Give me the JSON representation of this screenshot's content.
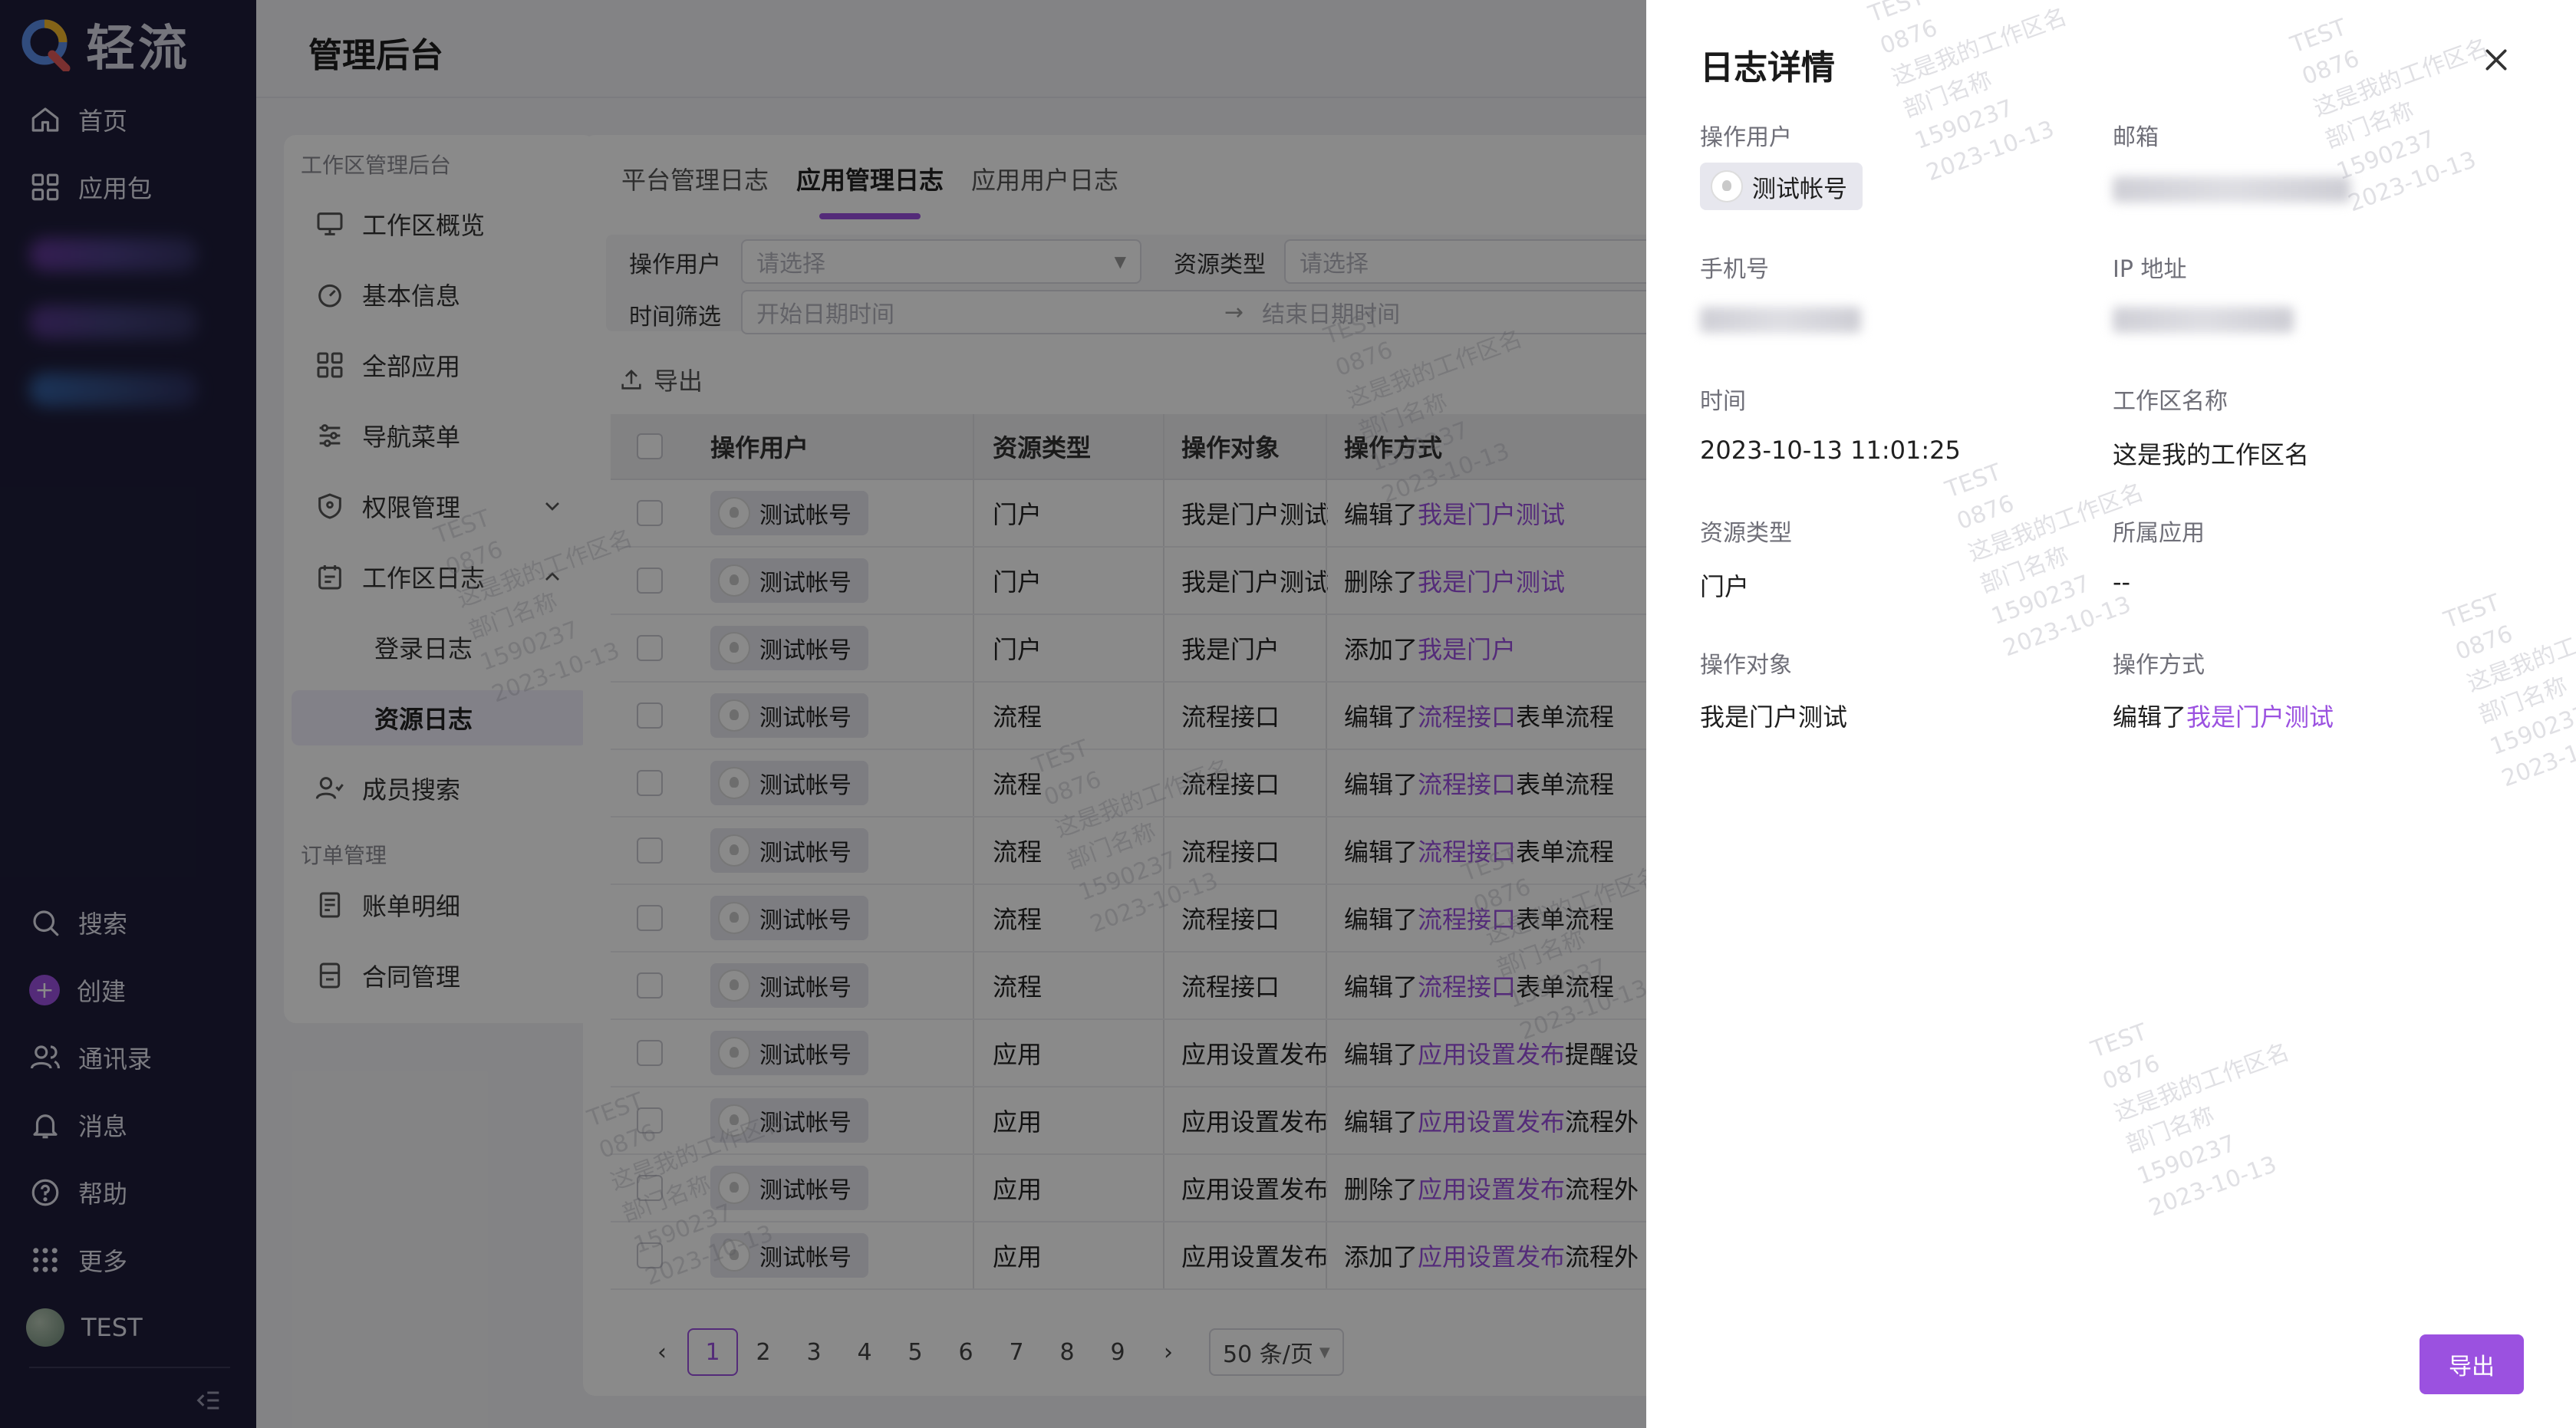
{
  "brand": {
    "name": "轻流"
  },
  "nav": {
    "top_items": [
      {
        "label": "首页",
        "icon": "home-icon"
      },
      {
        "label": "应用包",
        "icon": "grid-icon"
      }
    ],
    "bottom_items": [
      {
        "label": "搜索",
        "icon": "search-icon"
      },
      {
        "label": "创建",
        "icon": "plus-circle-icon"
      },
      {
        "label": "通讯录",
        "icon": "contacts-icon"
      },
      {
        "label": "消息",
        "icon": "bell-icon"
      },
      {
        "label": "帮助",
        "icon": "help-icon"
      },
      {
        "label": "更多",
        "icon": "apps-icon"
      },
      {
        "label": "TEST",
        "icon": "avatar"
      }
    ]
  },
  "header": {
    "title": "管理后台"
  },
  "sub_sidebar": {
    "group1": "工作区管理后台",
    "group2": "订单管理",
    "items": [
      {
        "label": "工作区概览"
      },
      {
        "label": "基本信息"
      },
      {
        "label": "全部应用"
      },
      {
        "label": "导航菜单"
      },
      {
        "label": "权限管理"
      },
      {
        "label": "工作区日志"
      },
      {
        "label": "登录日志"
      },
      {
        "label": "资源日志"
      },
      {
        "label": "成员搜索"
      },
      {
        "label": "账单明细"
      },
      {
        "label": "合同管理"
      }
    ]
  },
  "tabs": [
    "平台管理日志",
    "应用管理日志",
    "应用用户日志"
  ],
  "filters": {
    "operator_label": "操作用户",
    "operator_placeholder": "请选择",
    "resource_label": "资源类型",
    "resource_placeholder": "请选择",
    "time_label": "时间筛选",
    "start_placeholder": "开始日期时间",
    "end_placeholder": "结束日期时间",
    "range_arrow": "→"
  },
  "export_label": "导出",
  "table": {
    "headers": [
      "操作用户",
      "资源类型",
      "操作对象",
      "操作方式"
    ],
    "rows": [
      {
        "user": "测试帐号",
        "type": "门户",
        "object": "我是门户测试",
        "action_pre": "编辑了",
        "action_link": "我是门户测试",
        "action_post": ""
      },
      {
        "user": "测试帐号",
        "type": "门户",
        "object": "我是门户测试",
        "action_pre": "删除了",
        "action_link": "我是门户测试",
        "action_post": ""
      },
      {
        "user": "测试帐号",
        "type": "门户",
        "object": "我是门户",
        "action_pre": "添加了",
        "action_link": "我是门户",
        "action_post": ""
      },
      {
        "user": "测试帐号",
        "type": "流程",
        "object": "流程接口",
        "action_pre": "编辑了",
        "action_link": "流程接口",
        "action_post": "表单流程"
      },
      {
        "user": "测试帐号",
        "type": "流程",
        "object": "流程接口",
        "action_pre": "编辑了",
        "action_link": "流程接口",
        "action_post": "表单流程"
      },
      {
        "user": "测试帐号",
        "type": "流程",
        "object": "流程接口",
        "action_pre": "编辑了",
        "action_link": "流程接口",
        "action_post": "表单流程"
      },
      {
        "user": "测试帐号",
        "type": "流程",
        "object": "流程接口",
        "action_pre": "编辑了",
        "action_link": "流程接口",
        "action_post": "表单流程"
      },
      {
        "user": "测试帐号",
        "type": "流程",
        "object": "流程接口",
        "action_pre": "编辑了",
        "action_link": "流程接口",
        "action_post": "表单流程"
      },
      {
        "user": "测试帐号",
        "type": "应用",
        "object": "应用设置发布",
        "action_pre": "编辑了",
        "action_link": "应用设置发布",
        "action_post": "提醒设"
      },
      {
        "user": "测试帐号",
        "type": "应用",
        "object": "应用设置发布",
        "action_pre": "编辑了",
        "action_link": "应用设置发布",
        "action_post": "流程外"
      },
      {
        "user": "测试帐号",
        "type": "应用",
        "object": "应用设置发布",
        "action_pre": "删除了",
        "action_link": "应用设置发布",
        "action_post": "流程外"
      },
      {
        "user": "测试帐号",
        "type": "应用",
        "object": "应用设置发布",
        "action_pre": "添加了",
        "action_link": "应用设置发布",
        "action_post": "流程外"
      }
    ]
  },
  "pagination": {
    "prev": "‹",
    "next": "›",
    "pages": [
      "1",
      "2",
      "3",
      "4",
      "5",
      "6",
      "7",
      "8",
      "9"
    ],
    "current": "1",
    "page_size": "50 条/页"
  },
  "drawer": {
    "title": "日志详情",
    "fields": {
      "operator_label": "操作用户",
      "operator_value": "测试帐号",
      "email_label": "邮箱",
      "phone_label": "手机号",
      "ip_label": "IP 地址",
      "time_label": "时间",
      "time_value": "2023-10-13 11:01:25",
      "workspace_label": "工作区名称",
      "workspace_value": "这是我的工作区名",
      "resource_label": "资源类型",
      "resource_value": "门户",
      "app_label": "所属应用",
      "app_value": "--",
      "object_label": "操作对象",
      "object_value": "我是门户测试",
      "method_label": "操作方式",
      "method_pre": "编辑了",
      "method_link": "我是门户测试"
    },
    "export_button": "导出"
  },
  "watermark": {
    "l1": "TEST",
    "l2": "0876",
    "l3": "这是我的工作区名",
    "l4": "部门名称",
    "l5": "1590237",
    "l6": "2023-10-13"
  },
  "colors": {
    "accent": "#9b51e0",
    "nav_bg": "#1e1d3a"
  }
}
